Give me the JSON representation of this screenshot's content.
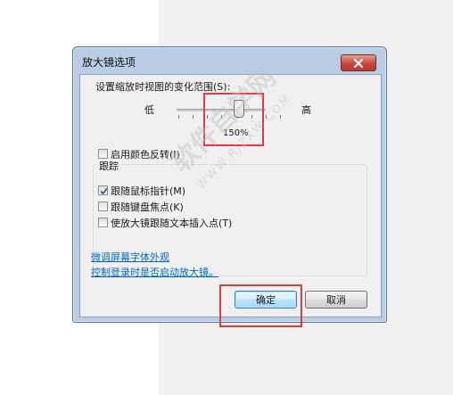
{
  "dialog": {
    "title": "放大镜选项",
    "zoom_label": "设置缩放时视图的变化范围(S):",
    "slider_low": "低",
    "slider_high": "高",
    "slider_value": "150%",
    "slider_level_percent": 150,
    "invert_colors": "启用颜色反转(I)",
    "invert_checked": false,
    "tracking_group": "跟踪",
    "follow_mouse": "跟随鼠标指针(M)",
    "follow_mouse_checked": true,
    "follow_keyboard": "跟随键盘焦点(K)",
    "follow_keyboard_checked": false,
    "follow_text_insertion": "使放大镜跟随文本插入点(T)",
    "follow_text_insertion_checked": false,
    "link_fine_tune": "微调屏幕字体外观",
    "link_logon": "控制登录时是否启动放大镜。",
    "ok_label": "确定",
    "cancel_label": "取消"
  },
  "watermark": {
    "text": "软件自学网",
    "url": "WWW.RJZXW.COM"
  },
  "colors": {
    "highlight_box": "#e23b3b",
    "link": "#0066cc"
  }
}
